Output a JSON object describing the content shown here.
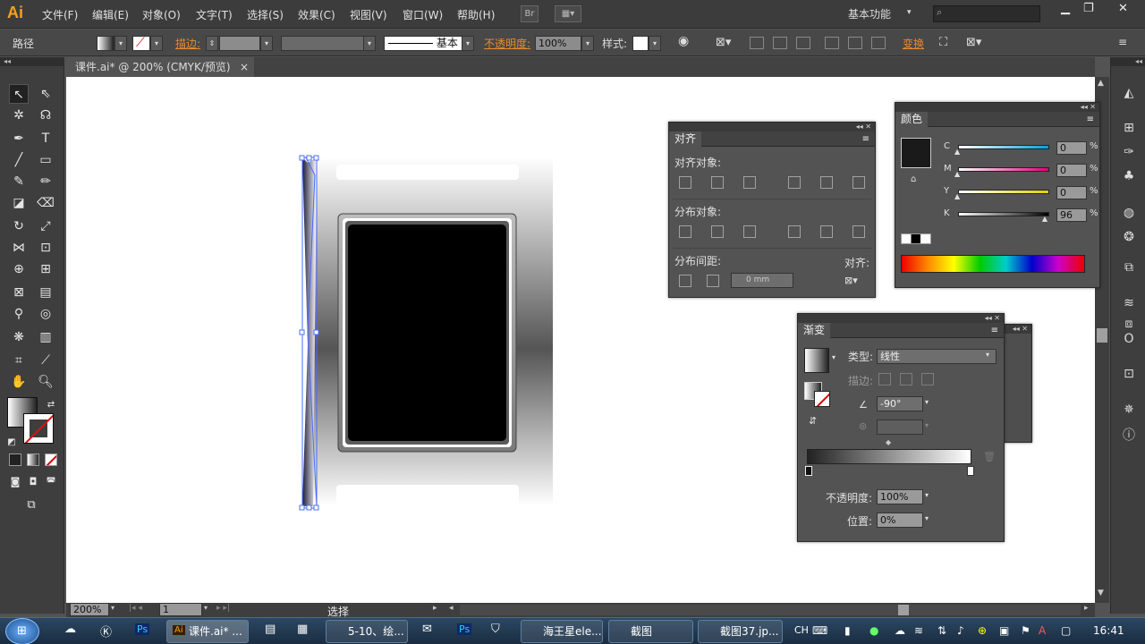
{
  "app": {
    "logo": "Ai",
    "workspace": "基本功能",
    "br_label": "Br",
    "search_placeholder": ""
  },
  "menu": [
    "文件(F)",
    "编辑(E)",
    "对象(O)",
    "文字(T)",
    "选择(S)",
    "效果(C)",
    "视图(V)",
    "窗口(W)",
    "帮助(H)"
  ],
  "control": {
    "object_type": "路径",
    "stroke_label": "描边:",
    "stroke_style": "基本",
    "opacity_label": "不透明度:",
    "opacity_value": "100%",
    "style_label": "样式:",
    "transform_label": "变换"
  },
  "document": {
    "tab_title": "课件.ai* @ 200% (CMYK/预览)",
    "close": "×"
  },
  "status": {
    "zoom": "200%",
    "page": "1",
    "tool_name": "选择"
  },
  "align_panel": {
    "title": "对齐",
    "align_objects": "对齐对象:",
    "distribute_objects": "分布对象:",
    "distribute_spacing": "分布间距:",
    "align_to": "对齐:",
    "spacing_value": "0 mm"
  },
  "color_panel": {
    "title": "颜色",
    "channels": [
      {
        "label": "C",
        "value": "0",
        "level": 0,
        "color": "#00a0e0"
      },
      {
        "label": "M",
        "value": "0",
        "level": 0,
        "color": "#e0007a"
      },
      {
        "label": "Y",
        "value": "0",
        "level": 0,
        "color": "#e0d000"
      },
      {
        "label": "K",
        "value": "96",
        "level": 96,
        "color": "#000000"
      }
    ],
    "percent": "%"
  },
  "gradient_panel": {
    "title": "渐变",
    "type_label": "类型:",
    "type_value": "线性",
    "stroke_label": "描边:",
    "angle_value": "-90°",
    "opacity_label": "不透明度:",
    "opacity_value": "100%",
    "position_label": "位置:",
    "position_value": "0%"
  },
  "taskbar": {
    "items": [
      "课件.ai* ...",
      "5-10、绘...",
      "海王星ele...",
      "截图",
      "截图37.jp..."
    ],
    "ime": "CH",
    "clock": "16:41"
  }
}
